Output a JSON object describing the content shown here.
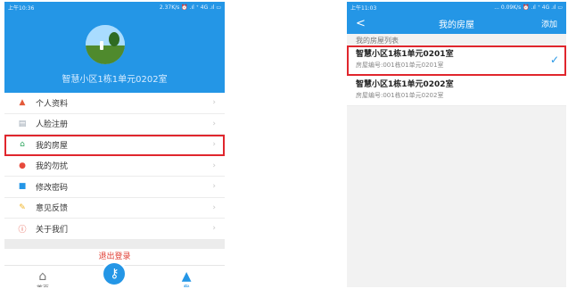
{
  "left": {
    "status": {
      "time": "上午10:36",
      "indicators": "2.37K/s ⏰ .ıl ⁺ 4G .ıl ▭"
    },
    "profile": {
      "name": "智慧小区1栋1单元0202室"
    },
    "menu": [
      {
        "icon": "person-icon",
        "glyph": "▲",
        "color": "#e35a3a",
        "label": "个人资料"
      },
      {
        "icon": "face-register-icon",
        "glyph": "▤",
        "color": "#9aa6b2",
        "label": "人脸注册"
      },
      {
        "icon": "house-icon",
        "glyph": "⌂",
        "color": "#27a35a",
        "label": "我的房屋"
      },
      {
        "icon": "bell-icon",
        "glyph": "●",
        "color": "#e64a3c",
        "label": "我的勿扰"
      },
      {
        "icon": "lock-icon",
        "glyph": "■",
        "color": "#2496e6",
        "label": "修改密码"
      },
      {
        "icon": "edit-icon",
        "glyph": "✎",
        "color": "#f0b429",
        "label": "意见反馈"
      },
      {
        "icon": "info-icon",
        "glyph": "ⓘ",
        "color": "#e34b3c",
        "label": "关于我们"
      }
    ],
    "logout": "退出登录",
    "tabs": {
      "home": "首页",
      "me": "我"
    }
  },
  "right": {
    "status": {
      "time": "上午11:03",
      "indicators": "... 0.09K/s ⏰ .ıl ⁺ 4G .ıl ▭"
    },
    "nav": {
      "back": "<",
      "title": "我的房屋",
      "add": "添加"
    },
    "section_title": "我的房屋列表",
    "houses": [
      {
        "name": "智慧小区1栋1单元0201室",
        "code": "房屋编号:001栋01单元0201室"
      },
      {
        "name": "智慧小区1栋1单元0202室",
        "code": "房屋编号:001栋01单元0202室"
      }
    ],
    "check": "✓"
  },
  "colors": {
    "brand": "#2496e6",
    "highlight": "#e0262d"
  }
}
